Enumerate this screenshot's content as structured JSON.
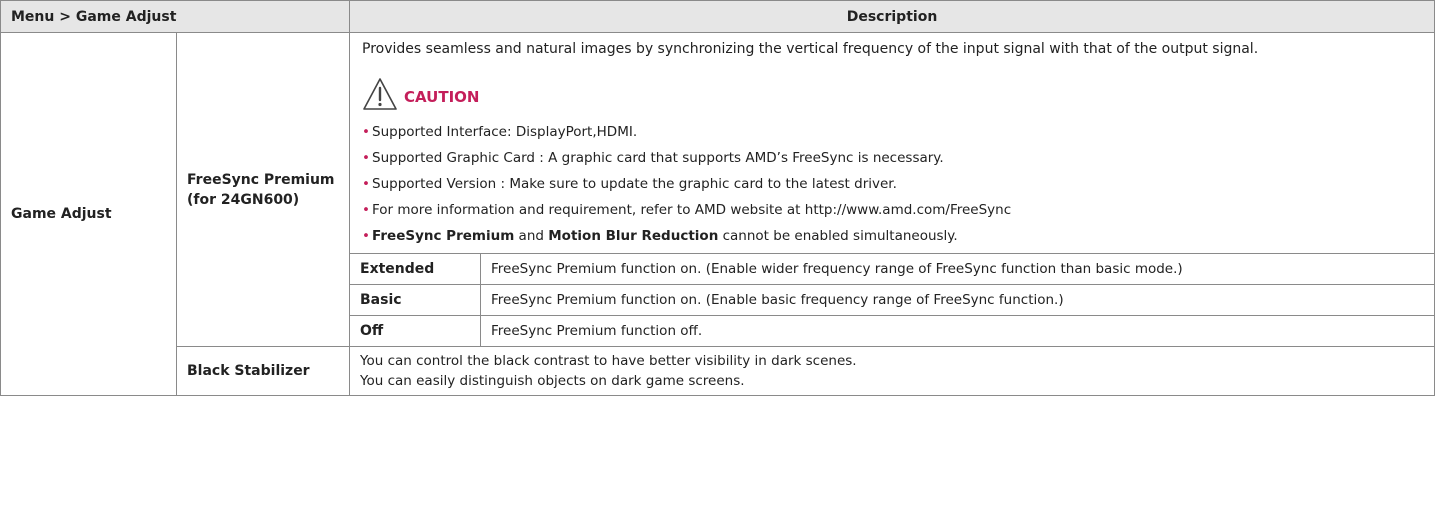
{
  "header": {
    "menu_path": "Menu > Game Adjust",
    "description": "Description"
  },
  "game_adjust_label": "Game Adjust",
  "freesync": {
    "label_line1": "FreeSync Premium",
    "label_line2": "(for 24GN600)",
    "intro": "Provides seamless and natural images by synchronizing the vertical frequency of the input signal with that of the output signal.",
    "caution_label": "CAUTION",
    "notes": [
      "Supported Interface: DisplayPort,HDMI.",
      "Supported Graphic Card : A graphic card that supports AMD’s FreeSync is necessary.",
      "Supported Version : Make sure to update the graphic card to the latest driver.",
      "For more information and requirement, refer to AMD website at http://www.amd.com/FreeSync"
    ],
    "last_note": {
      "bold1": "FreeSync Premium",
      "and": " and ",
      "bold2": "Motion Blur Reduction",
      "rest": " cannot be enabled simultaneously."
    },
    "bullet": "•",
    "options": [
      {
        "name": "Extended",
        "desc": "FreeSync Premium function on. (Enable wider frequency range of FreeSync function than basic mode.)"
      },
      {
        "name": "Basic",
        "desc": "FreeSync Premium function on. (Enable basic frequency range of FreeSync function.)"
      },
      {
        "name": "Off",
        "desc": "FreeSync Premium function off."
      }
    ]
  },
  "black_stabilizer": {
    "label": "Black Stabilizer",
    "line1": "You can control the black contrast to have better visibility in dark scenes.",
    "line2": "You can easily distinguish objects on dark game screens."
  },
  "colors": {
    "header_bg": "#e6e6e6",
    "border": "#8a8a8a",
    "caution_accent": "#c41e5a"
  },
  "icons": {
    "caution": "warning-triangle-icon"
  }
}
